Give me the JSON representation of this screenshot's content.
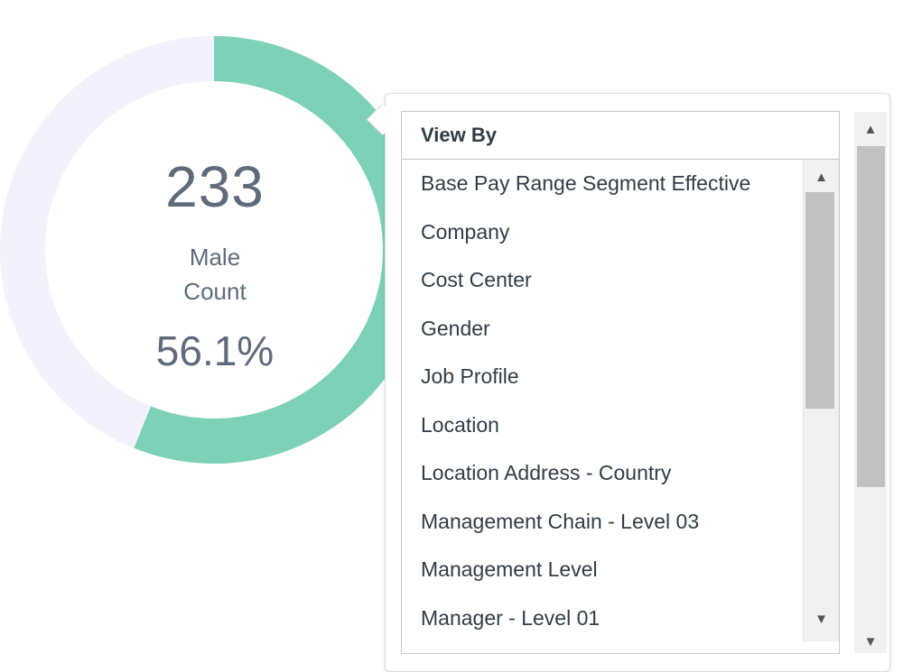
{
  "summary": {
    "count": "233",
    "label_line1": "Male",
    "label_line2": "Count",
    "percent": "56.1%",
    "percent_value": 0.561
  },
  "colors": {
    "donut_filled": "#7dd1b7",
    "donut_track": "#f3f1fb",
    "text": "#5f6b7a"
  },
  "popup": {
    "header": "View By",
    "items": [
      "Base Pay Range Segment Effective",
      "Company",
      "Cost Center",
      "Gender",
      "Job Profile",
      "Location",
      "Location Address - Country",
      "Management Chain - Level 03",
      "Management Level",
      "Manager - Level 01"
    ]
  },
  "icons": {
    "scroll_up": "caret-up-icon",
    "scroll_down": "caret-down-icon"
  }
}
